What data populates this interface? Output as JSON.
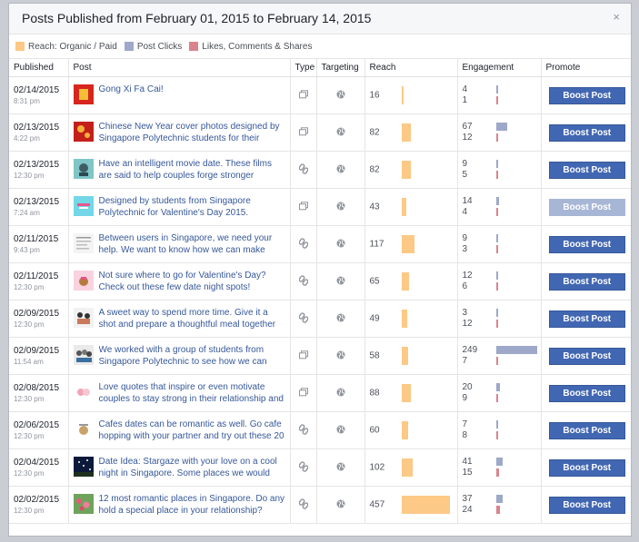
{
  "header": {
    "title": "Posts Published from February 01, 2015 to February 14, 2015",
    "close_glyph": "×"
  },
  "legend": [
    {
      "label": "Reach: Organic / Paid",
      "color": "#fcc986"
    },
    {
      "label": "Post Clicks",
      "color": "#9ea8c9"
    },
    {
      "label": "Likes, Comments & Shares",
      "color": "#d9848d"
    }
  ],
  "columns": {
    "published": "Published",
    "post": "Post",
    "type": "Type",
    "targeting": "Targeting",
    "reach": "Reach",
    "engagement": "Engagement",
    "promote": "Promote"
  },
  "max": {
    "reach": 457,
    "engagement": 249
  },
  "rows": [
    {
      "date": "02/14/2015",
      "time": "8:31 pm",
      "text": "Gong Xi Fa Cai!",
      "type": "photo",
      "reach": 16,
      "clicks": 4,
      "likes": 1,
      "boost": "Boost Post",
      "boost_enabled": true,
      "thumb": "red"
    },
    {
      "date": "02/13/2015",
      "time": "4:22 pm",
      "text": "Chinese New Year cover photos designed by Singapore Polytechnic students for their social",
      "type": "photo",
      "reach": 82,
      "clicks": 67,
      "likes": 12,
      "boost": "Boost Post",
      "boost_enabled": true,
      "thumb": "red2"
    },
    {
      "date": "02/13/2015",
      "time": "12:30 pm",
      "text": "Have an intelligent movie date. These films are said to help couples forge stronger relationships",
      "type": "link",
      "reach": 82,
      "clicks": 9,
      "likes": 5,
      "boost": "Boost Post",
      "boost_enabled": true,
      "thumb": "teal"
    },
    {
      "date": "02/13/2015",
      "time": "7:24 am",
      "text": "Designed by students from Singapore Polytechnic for Valentine's Day 2015.",
      "type": "photo",
      "reach": 43,
      "clicks": 14,
      "likes": 4,
      "boost": "Boost Post",
      "boost_enabled": false,
      "thumb": "cyan"
    },
    {
      "date": "02/11/2015",
      "time": "9:43 pm",
      "text": "Between users in Singapore, we need your help. We want to know how we can make Between",
      "type": "link",
      "reach": 117,
      "clicks": 9,
      "likes": 3,
      "boost": "Boost Post",
      "boost_enabled": true,
      "thumb": "doc"
    },
    {
      "date": "02/11/2015",
      "time": "12:30 pm",
      "text": "Not sure where to go for Valentine's Day? Check out these few date night spots!",
      "type": "link",
      "reach": 65,
      "clicks": 12,
      "likes": 6,
      "boost": "Boost Post",
      "boost_enabled": true,
      "thumb": "pink"
    },
    {
      "date": "02/09/2015",
      "time": "12:30 pm",
      "text": "A sweet way to spend more time. Give it a shot and prepare a thoughtful meal together instead",
      "type": "link",
      "reach": 49,
      "clicks": 3,
      "likes": 12,
      "boost": "Boost Post",
      "boost_enabled": true,
      "thumb": "cook"
    },
    {
      "date": "02/09/2015",
      "time": "11:54 am",
      "text": "We worked with a group of students from Singapore Polytechnic to see how we can give",
      "type": "photo",
      "reach": 58,
      "clicks": 249,
      "likes": 7,
      "boost": "Boost Post",
      "boost_enabled": true,
      "thumb": "group"
    },
    {
      "date": "02/08/2015",
      "time": "12:30 pm",
      "text": "Love quotes that inspire or even motivate couples to stay strong in their relationship and",
      "type": "photo",
      "reach": 88,
      "clicks": 20,
      "likes": 9,
      "boost": "Boost Post",
      "boost_enabled": true,
      "thumb": "quote"
    },
    {
      "date": "02/06/2015",
      "time": "12:30 pm",
      "text": "Cafes dates can be romantic as well. Go cafe hopping with your partner and try out these 20",
      "type": "link",
      "reach": 60,
      "clicks": 7,
      "likes": 8,
      "boost": "Boost Post",
      "boost_enabled": true,
      "thumb": "cafe"
    },
    {
      "date": "02/04/2015",
      "time": "12:30 pm",
      "text": "Date Idea: Stargaze with your love on a cool night in Singapore. Some places we would",
      "type": "link",
      "reach": 102,
      "clicks": 41,
      "likes": 15,
      "boost": "Boost Post",
      "boost_enabled": true,
      "thumb": "night"
    },
    {
      "date": "02/02/2015",
      "time": "12:30 pm",
      "text": "12 most romantic places in Singapore. Do any hold a special place in your relationship?",
      "type": "link",
      "reach": 457,
      "clicks": 37,
      "likes": 24,
      "boost": "Boost Post",
      "boost_enabled": true,
      "thumb": "flower"
    }
  ]
}
